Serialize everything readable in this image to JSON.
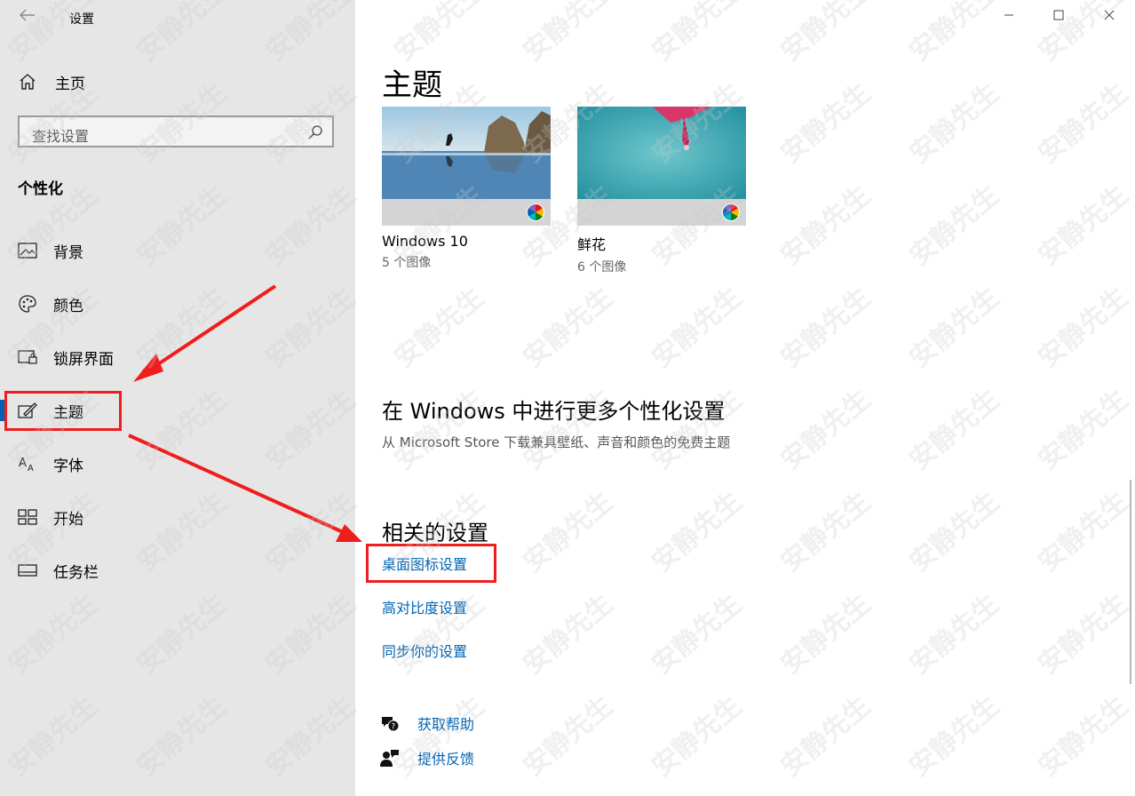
{
  "window": {
    "title": "设置"
  },
  "sidebar": {
    "home_label": "主页",
    "search_placeholder": "查找设置",
    "section_title": "个性化",
    "items": [
      {
        "label": "背景",
        "icon": "picture-icon"
      },
      {
        "label": "颜色",
        "icon": "palette-icon"
      },
      {
        "label": "锁屏界面",
        "icon": "lock-screen-icon"
      },
      {
        "label": "主题",
        "icon": "theme-brush-icon",
        "active": true
      },
      {
        "label": "字体",
        "icon": "font-icon"
      },
      {
        "label": "开始",
        "icon": "start-grid-icon"
      },
      {
        "label": "任务栏",
        "icon": "taskbar-icon"
      }
    ]
  },
  "main": {
    "title": "主题",
    "themes": [
      {
        "name": "Windows 10",
        "count": "5 个图像"
      },
      {
        "name": "鲜花",
        "count": "6 个图像"
      }
    ],
    "more_title": "在 Windows 中进行更多个性化设置",
    "more_desc": "从 Microsoft Store 下载兼具壁纸、声音和颜色的免费主题",
    "related_title": "相关的设置",
    "related_links": [
      "桌面图标设置",
      "高对比度设置",
      "同步你的设置"
    ],
    "help_links": [
      {
        "label": "获取帮助",
        "icon": "help-chat-icon"
      },
      {
        "label": "提供反馈",
        "icon": "feedback-person-icon"
      }
    ]
  },
  "watermark_text": "安静先生",
  "colors": {
    "accent": "#0063b1",
    "annotation": "#f01d1d",
    "sidebar_bg": "#e6e6e6"
  }
}
